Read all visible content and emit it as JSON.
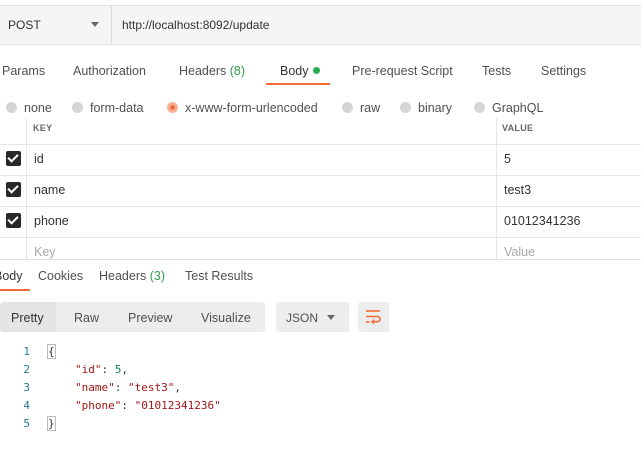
{
  "request": {
    "method": "POST",
    "url": "http://localhost:8092/update"
  },
  "request_tabs": [
    {
      "label": "Params"
    },
    {
      "label": "Authorization"
    },
    {
      "label": "Headers",
      "count": "(8)"
    },
    {
      "label": "Body",
      "active": true
    },
    {
      "label": "Pre-request Script"
    },
    {
      "label": "Tests"
    },
    {
      "label": "Settings"
    }
  ],
  "body_types": [
    {
      "label": "none"
    },
    {
      "label": "form-data"
    },
    {
      "label": "x-www-form-urlencoded",
      "selected": true
    },
    {
      "label": "raw"
    },
    {
      "label": "binary"
    },
    {
      "label": "GraphQL"
    }
  ],
  "params_table": {
    "headers": {
      "key": "KEY",
      "value": "VALUE"
    },
    "rows": [
      {
        "key": "id",
        "value": "5",
        "checked": true
      },
      {
        "key": "name",
        "value": "test3",
        "checked": true
      },
      {
        "key": "phone",
        "value": "01012341236",
        "checked": true
      }
    ],
    "placeholder": {
      "key": "Key",
      "value": "Value"
    }
  },
  "response_tabs": [
    {
      "label": "Body",
      "active": true
    },
    {
      "label": "Cookies"
    },
    {
      "label": "Headers",
      "count": "(3)"
    },
    {
      "label": "Test Results"
    }
  ],
  "view_modes": [
    "Pretty",
    "Raw",
    "Preview",
    "Visualize"
  ],
  "format": "JSON",
  "code_lines": [
    "1",
    "2",
    "3",
    "4",
    "5"
  ],
  "response_json": {
    "open": "{",
    "close": "}",
    "fields": [
      {
        "key": "\"id\"",
        "value": "5",
        "sep": ","
      },
      {
        "key": "\"name\"",
        "value": "\"test3\"",
        "sep": ","
      },
      {
        "key": "\"phone\"",
        "value": "\"01012341236\"",
        "sep": ""
      }
    ]
  },
  "colors": {
    "accent": "#f26b3a",
    "count_green": "#2e9e4e",
    "body_dot": "#26b04f"
  },
  "icons": [
    "dropdown-caret-icon",
    "checkbox-checked-icon",
    "radio-icon",
    "word-wrap-icon"
  ]
}
